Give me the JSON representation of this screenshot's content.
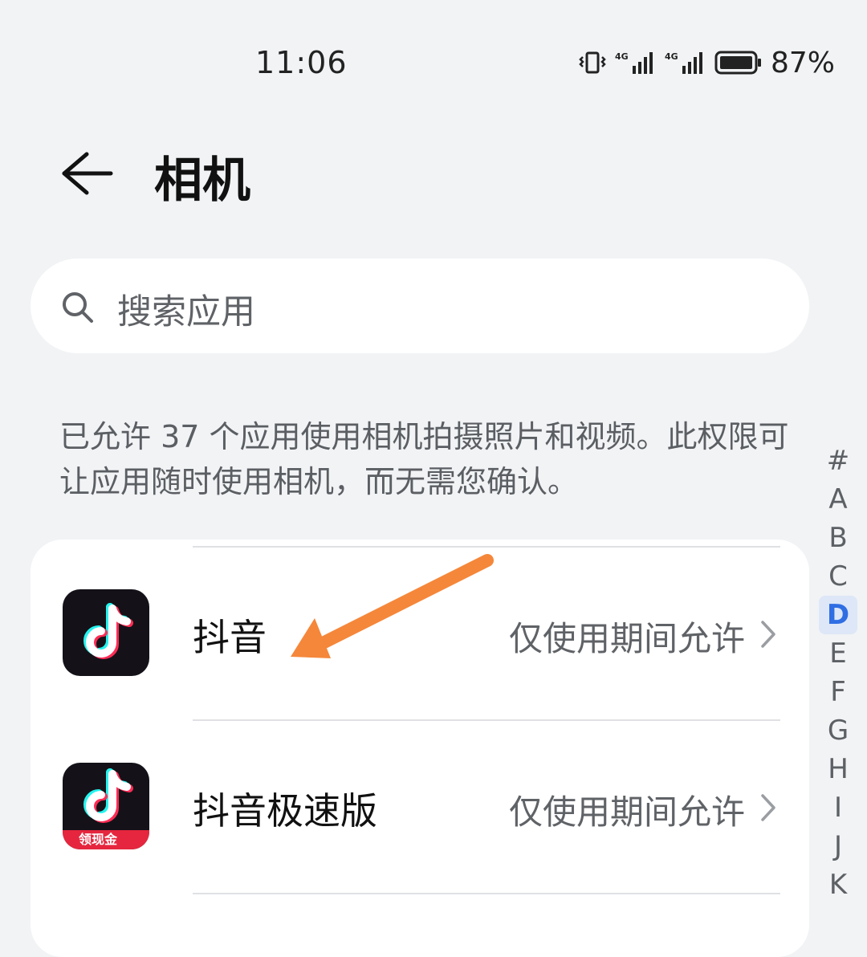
{
  "status_bar": {
    "time": "11:06",
    "battery": "87%"
  },
  "header": {
    "title": "相机"
  },
  "search": {
    "placeholder": "搜索应用"
  },
  "description": "已允许 37 个应用使用相机拍摄照片和视频。此权限可让应用随时使用相机，而无需您确认。",
  "index": {
    "letters": [
      "#",
      "A",
      "B",
      "C",
      "D",
      "E",
      "F",
      "G",
      "H",
      "I",
      "J",
      "K"
    ],
    "active": "D"
  },
  "apps": [
    {
      "name": "抖音",
      "status": "仅使用期间允许",
      "icon": "douyin-icon"
    },
    {
      "name": "抖音极速版",
      "status": "仅使用期间允许",
      "icon": "douyin-lite-icon",
      "icon_badge": "领现金"
    }
  ],
  "colors": {
    "background": "#f1f3f5",
    "accent": "#2f6ee3",
    "annotation_arrow": "#f5873a"
  }
}
